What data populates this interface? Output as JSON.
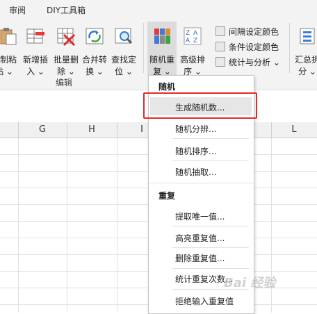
{
  "tabs": [
    "审阅",
    "DIY工具箱"
  ],
  "ribbon": {
    "buttons": [
      {
        "line1": "复制粘",
        "line2": "贴 ⌄"
      },
      {
        "line1": "新增插",
        "line2": "入 ⌄"
      },
      {
        "line1": "批量删",
        "line2": "除 ⌄"
      },
      {
        "line1": "合并转",
        "line2": "换 ⌄"
      },
      {
        "line1": "查找定",
        "line2": "位 ⌄"
      },
      {
        "line1": "随机重",
        "line2": "复 ⌄"
      },
      {
        "line1": "高级排",
        "line2": "序 ⌄"
      },
      {
        "line1": "汇总拆",
        "line2": "分 ⌄"
      }
    ],
    "small_buttons": [
      "间隔设定颜色",
      "条件设定颜色",
      "统计与分析 ⌄"
    ],
    "group_label": "编辑",
    "sort_icon_text": [
      "Z",
      "A",
      "A",
      "Z"
    ]
  },
  "columns": [
    "G",
    "H",
    "I",
    "L"
  ],
  "menu": {
    "section1": "随机",
    "items1": [
      "生成随机数...",
      "随机分辨...",
      "随机排序...",
      "随机抽取..."
    ],
    "section2": "重复",
    "items2": [
      "提取唯一值...",
      "高亮重复值...",
      "删除重复值...",
      "统计重复次数...",
      "拒绝输入重复值"
    ]
  },
  "watermark": "Bai 经验",
  "colors": {
    "highlight_box": "#e02a2a",
    "menu_hover": "#e6e6e6",
    "ribbon_bg": "#f3f3f3"
  }
}
